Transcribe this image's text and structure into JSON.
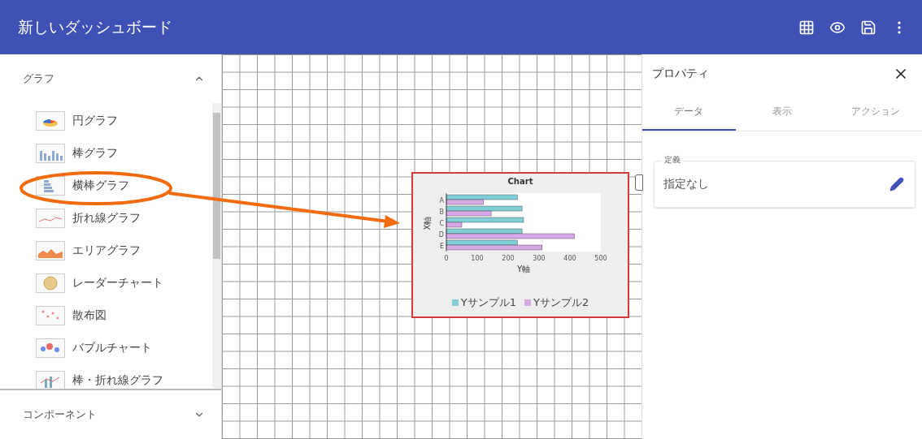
{
  "header": {
    "title": "新しいダッシュボード"
  },
  "sidebar": {
    "sections": [
      {
        "title": "グラフ",
        "expanded": true,
        "items": [
          {
            "label": "円グラフ",
            "kind": "pie"
          },
          {
            "label": "棒グラフ",
            "kind": "bar"
          },
          {
            "label": "横棒グラフ",
            "kind": "hbar"
          },
          {
            "label": "折れ線グラフ",
            "kind": "line"
          },
          {
            "label": "エリアグラフ",
            "kind": "area"
          },
          {
            "label": "レーダーチャート",
            "kind": "radar"
          },
          {
            "label": "散布図",
            "kind": "scatter"
          },
          {
            "label": "バブルチャート",
            "kind": "bubble"
          },
          {
            "label": "棒・折れ線グラフ",
            "kind": "combo"
          }
        ]
      },
      {
        "title": "コンポーネント",
        "expanded": false
      }
    ]
  },
  "canvas": {
    "widget": {
      "chart_data": {
        "type": "bar",
        "orientation": "horizontal",
        "title": "Chart",
        "xlabel": "Y軸",
        "ylabel": "X軸",
        "categories": [
          "A",
          "B",
          "C",
          "D",
          "E"
        ],
        "series": [
          {
            "name": "Yサンプル1",
            "color": "#80cfd6",
            "values": [
              230,
              245,
              250,
              245,
              230
            ]
          },
          {
            "name": "Yサンプル2",
            "color": "#d9a8e6",
            "values": [
              120,
              145,
              50,
              415,
              310
            ]
          }
        ],
        "xlim": [
          0,
          500
        ],
        "xticks": [
          0,
          100,
          200,
          300,
          400,
          500
        ]
      }
    }
  },
  "properties": {
    "title": "プロパティ",
    "tabs": [
      {
        "label": "データ",
        "selected": true
      },
      {
        "label": "表示",
        "selected": false
      },
      {
        "label": "アクション",
        "selected": false
      }
    ],
    "field": {
      "label": "定義",
      "value": "指定なし"
    }
  }
}
